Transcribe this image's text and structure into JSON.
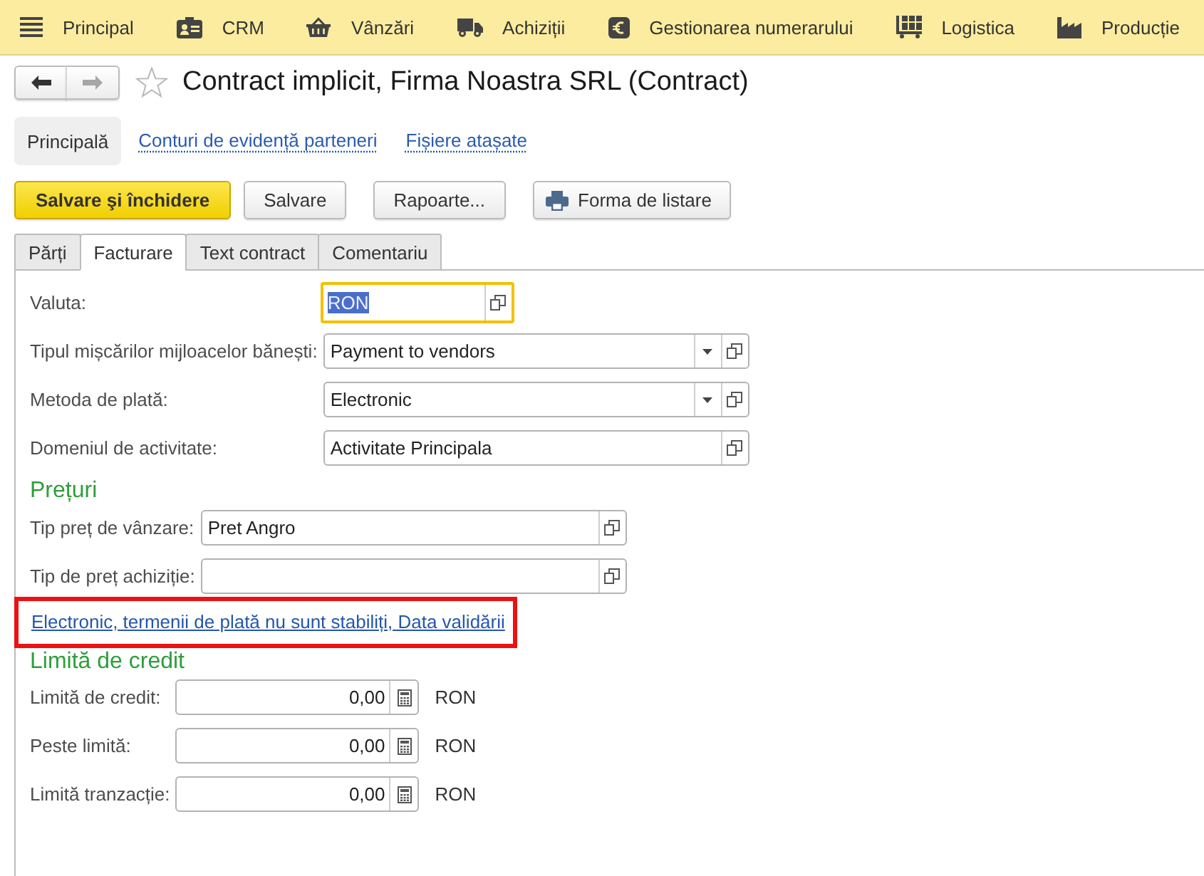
{
  "menu_bar": {
    "items": [
      {
        "label": "Principal"
      },
      {
        "label": "CRM"
      },
      {
        "label": "Vânzări"
      },
      {
        "label": "Achiziții"
      },
      {
        "label": "Gestionarea numerarului"
      },
      {
        "label": "Logistica"
      },
      {
        "label": "Producție"
      }
    ]
  },
  "navigation": {
    "back_disabled": false,
    "forward_disabled": true
  },
  "header": {
    "title": "Contract implicit, Firma Noastra SRL (Contract)",
    "favorite": false
  },
  "sections": [
    {
      "label": "Principală",
      "selected": true
    },
    {
      "label": "Conturi de evidență parteneri",
      "selected": false
    },
    {
      "label": "Fișiere atașate",
      "selected": false
    }
  ],
  "command_bar": {
    "buttons": [
      {
        "label": "Salvare şi închidere",
        "default": true,
        "kind": "plain"
      },
      {
        "label": "Salvare",
        "default": false,
        "kind": "plain"
      },
      {
        "label": "Rapoarte...",
        "default": false,
        "kind": "plain"
      },
      {
        "label": "Forma de listare",
        "default": false,
        "kind": "print"
      }
    ]
  },
  "tabs": [
    {
      "label": "Părți",
      "selected": false
    },
    {
      "label": "Facturare",
      "selected": true
    },
    {
      "label": "Text contract",
      "selected": false
    },
    {
      "label": "Comentariu",
      "selected": false
    }
  ],
  "main_fields": [
    {
      "label": "Valuta:",
      "value": "RON",
      "focused": true,
      "dropdown": false
    },
    {
      "label": "Tipul mișcărilor mijloacelor bănești:",
      "value": "Payment to vendors",
      "focused": false,
      "dropdown": true
    },
    {
      "label": "Metoda de plată:",
      "value": "Electronic",
      "focused": false,
      "dropdown": true
    },
    {
      "label": "Domeniul de activitate:",
      "value": "Activitate Principala",
      "focused": false,
      "dropdown": false
    }
  ],
  "prices": {
    "title": "Prețuri",
    "fields": [
      {
        "label": "Tip preț de vânzare:",
        "value": "Pret Angro"
      },
      {
        "label": "Tip de preț achiziție:"
      }
    ]
  },
  "payment_terms": {
    "link": "Electronic, termenii de plată nu sunt stabiliți, Data validării",
    "highlighted": true
  },
  "credit_limit": {
    "title": "Limită de credit",
    "fields": [
      {
        "label": "Limită de credit:",
        "value": "0,00",
        "unit": "RON"
      },
      {
        "label": "Peste limită:",
        "value": "0,00",
        "unit": "RON"
      },
      {
        "label": "Limită tranzacție:",
        "value": "0,00",
        "unit": "RON"
      }
    ]
  }
}
